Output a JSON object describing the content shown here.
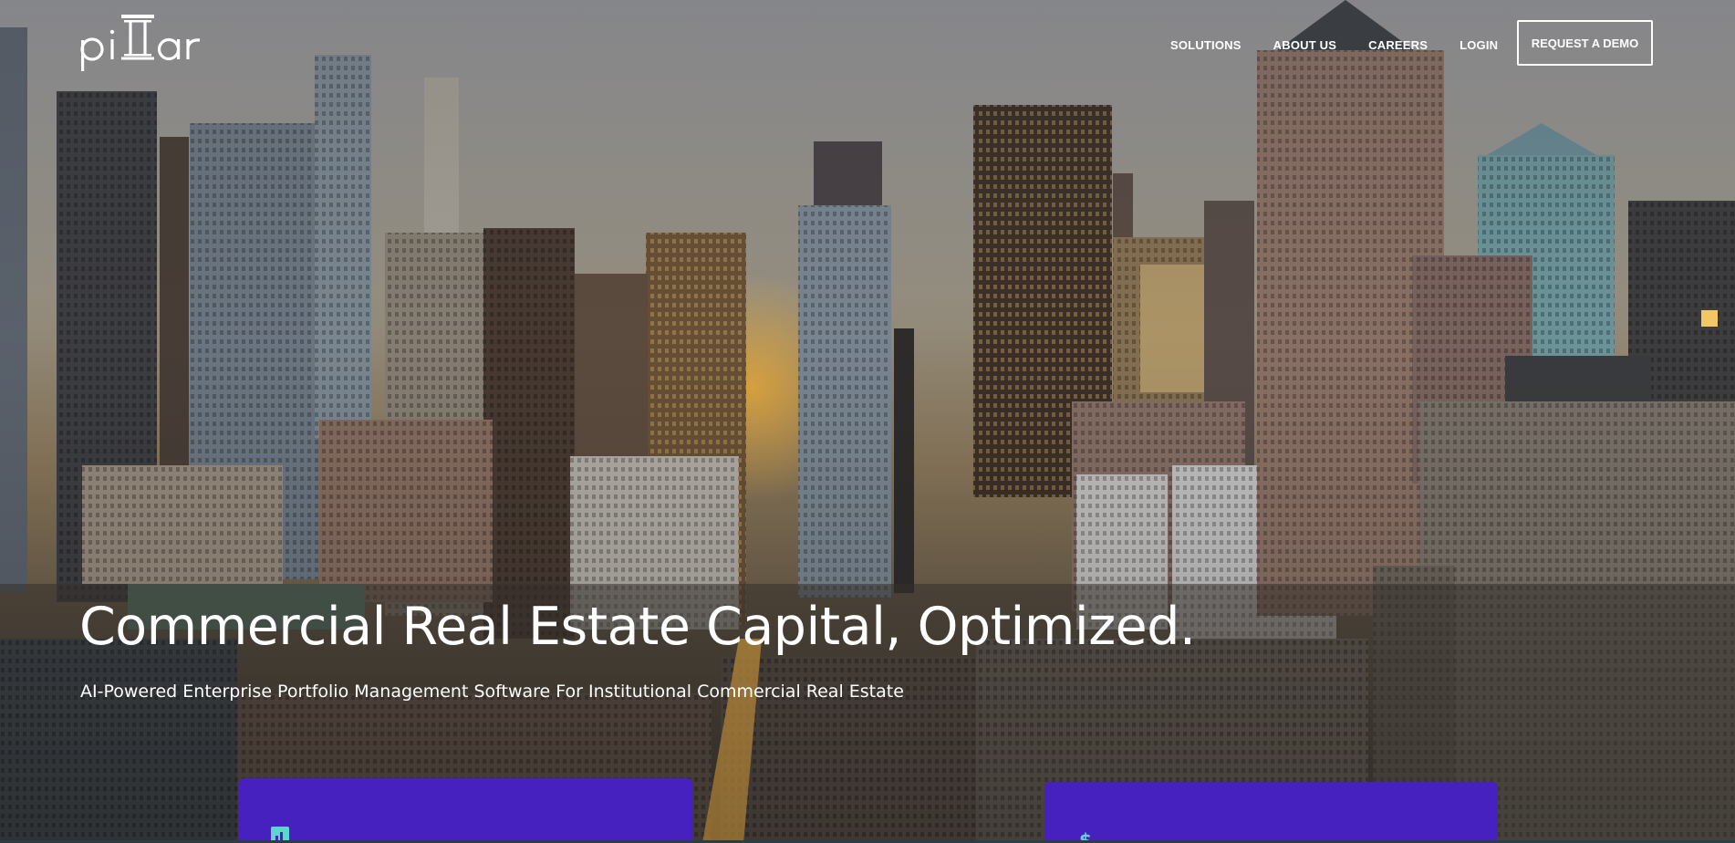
{
  "brand": {
    "logo_text": "pillar"
  },
  "nav": {
    "items": [
      {
        "label": "SOLUTIONS"
      },
      {
        "label": "ABOUT US"
      },
      {
        "label": "CAREERS"
      },
      {
        "label": "LOGIN"
      }
    ],
    "cta_label": "REQUEST A DEMO"
  },
  "hero": {
    "headline": "Commercial Real Estate Capital, Optimized.",
    "subheadline": "AI-Powered Enterprise Portfolio Management Software For Institutional Commercial Real Estate",
    "background": "city skyline photo at sunset"
  },
  "cards": [
    {
      "icon": "bar-chart-icon"
    },
    {
      "icon": "dollar-icon"
    }
  ],
  "colors": {
    "accent": "#4721bf",
    "icon": "#5fd4d0",
    "text": "#ffffff"
  }
}
